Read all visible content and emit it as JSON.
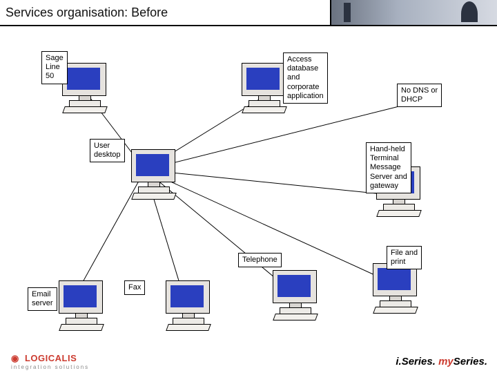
{
  "title": "Services organisation: Before",
  "nodes": {
    "sage": {
      "label": "Sage\nLine\n50"
    },
    "access": {
      "label": "Access\ndatabase\nand\ncorporate\napplication"
    },
    "nodns": {
      "label": "No DNS or\nDHCP"
    },
    "user": {
      "label": "User\ndesktop"
    },
    "hht": {
      "label": "Hand-held\nTerminal\nMessage\nServer and\ngateway"
    },
    "telephone": {
      "label": "Telephone"
    },
    "fileprint": {
      "label": "File and\nprint"
    },
    "email": {
      "label": "Email\nserver"
    },
    "fax": {
      "label": "Fax"
    }
  },
  "branding": {
    "company": "LOGICALIS",
    "tagline": "integration solutions",
    "footer_left": "i.Series.",
    "footer_my": "my",
    "footer_right": "Series."
  },
  "chart_data": {
    "type": "diagram",
    "title": "Services organisation: Before",
    "nodes": [
      {
        "id": "user",
        "label": "User desktop",
        "role": "hub"
      },
      {
        "id": "sage",
        "label": "Sage Line 50"
      },
      {
        "id": "access",
        "label": "Access database and corporate application"
      },
      {
        "id": "nodns",
        "label": "No DNS or DHCP"
      },
      {
        "id": "hht",
        "label": "Hand-held Terminal Message Server and gateway"
      },
      {
        "id": "fileprint",
        "label": "File and print"
      },
      {
        "id": "telephone",
        "label": "Telephone"
      },
      {
        "id": "fax",
        "label": "Fax"
      },
      {
        "id": "email",
        "label": "Email server"
      }
    ],
    "edges": [
      {
        "from": "user",
        "to": "sage"
      },
      {
        "from": "user",
        "to": "access"
      },
      {
        "from": "user",
        "to": "nodns"
      },
      {
        "from": "user",
        "to": "hht"
      },
      {
        "from": "user",
        "to": "fileprint"
      },
      {
        "from": "user",
        "to": "telephone"
      },
      {
        "from": "user",
        "to": "fax"
      },
      {
        "from": "user",
        "to": "email"
      }
    ]
  }
}
